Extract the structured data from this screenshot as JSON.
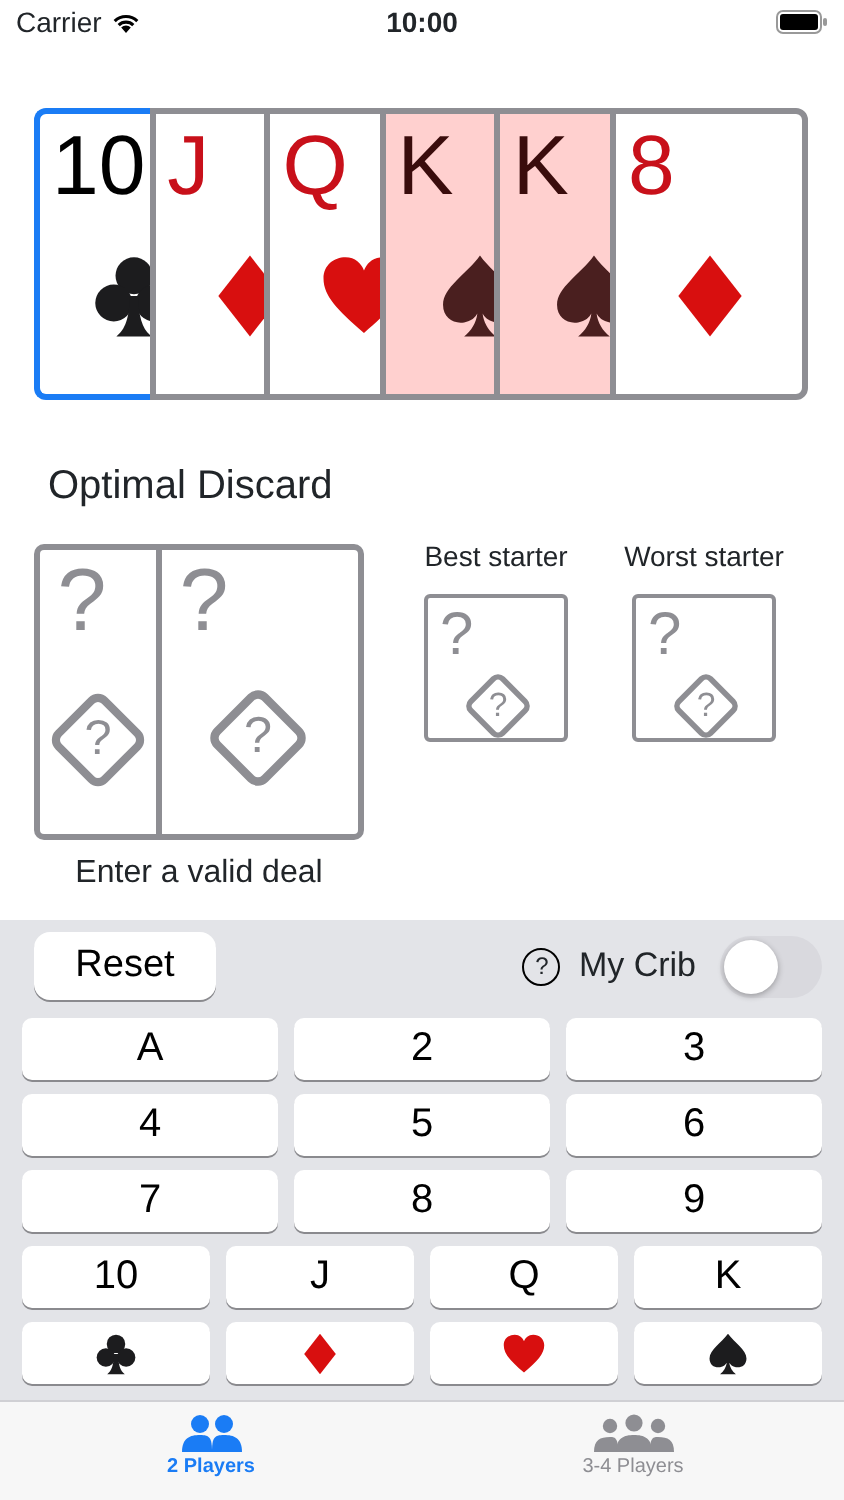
{
  "status_bar": {
    "carrier": "Carrier",
    "time": "10:00"
  },
  "hand": [
    {
      "rank": "10",
      "kind": "clubs",
      "selected": true,
      "highlighted": false
    },
    {
      "rank": "J",
      "kind": "diamonds",
      "selected": false,
      "highlighted": false
    },
    {
      "rank": "Q",
      "kind": "hearts",
      "selected": false,
      "highlighted": false
    },
    {
      "rank": "K",
      "kind": "spades",
      "selected": false,
      "highlighted": true
    },
    {
      "rank": "K",
      "kind": "spades",
      "selected": false,
      "highlighted": true
    },
    {
      "rank": "8",
      "kind": "diamonds",
      "selected": false,
      "highlighted": false
    }
  ],
  "discard": {
    "title": "Optimal Discard",
    "cards": [
      {
        "rank": "?",
        "mark": "?"
      },
      {
        "rank": "?",
        "mark": "?"
      }
    ],
    "message": "Enter a valid deal"
  },
  "starters": [
    {
      "label": "Best starter",
      "card": {
        "rank": "?",
        "mark": "?"
      }
    },
    {
      "label": "Worst starter",
      "card": {
        "rank": "?",
        "mark": "?"
      }
    }
  ],
  "controls": {
    "reset": "Reset",
    "help": "?",
    "crib_label": "My Crib",
    "crib_on": false
  },
  "keypad": {
    "rows": [
      [
        {
          "label": "A"
        },
        {
          "label": "2"
        },
        {
          "label": "3"
        }
      ],
      [
        {
          "label": "4"
        },
        {
          "label": "5"
        },
        {
          "label": "6"
        }
      ],
      [
        {
          "label": "7"
        },
        {
          "label": "8"
        },
        {
          "label": "9"
        }
      ],
      [
        {
          "label": "10"
        },
        {
          "label": "J"
        },
        {
          "label": "Q"
        },
        {
          "label": "K"
        }
      ]
    ],
    "suits": [
      {
        "kind": "clubs"
      },
      {
        "kind": "diamonds"
      },
      {
        "kind": "hearts"
      },
      {
        "kind": "spades"
      }
    ]
  },
  "tabs": [
    {
      "label": "2 Players",
      "kind": "two",
      "selected": true
    },
    {
      "label": "3-4 Players",
      "kind": "three",
      "selected": false
    }
  ]
}
